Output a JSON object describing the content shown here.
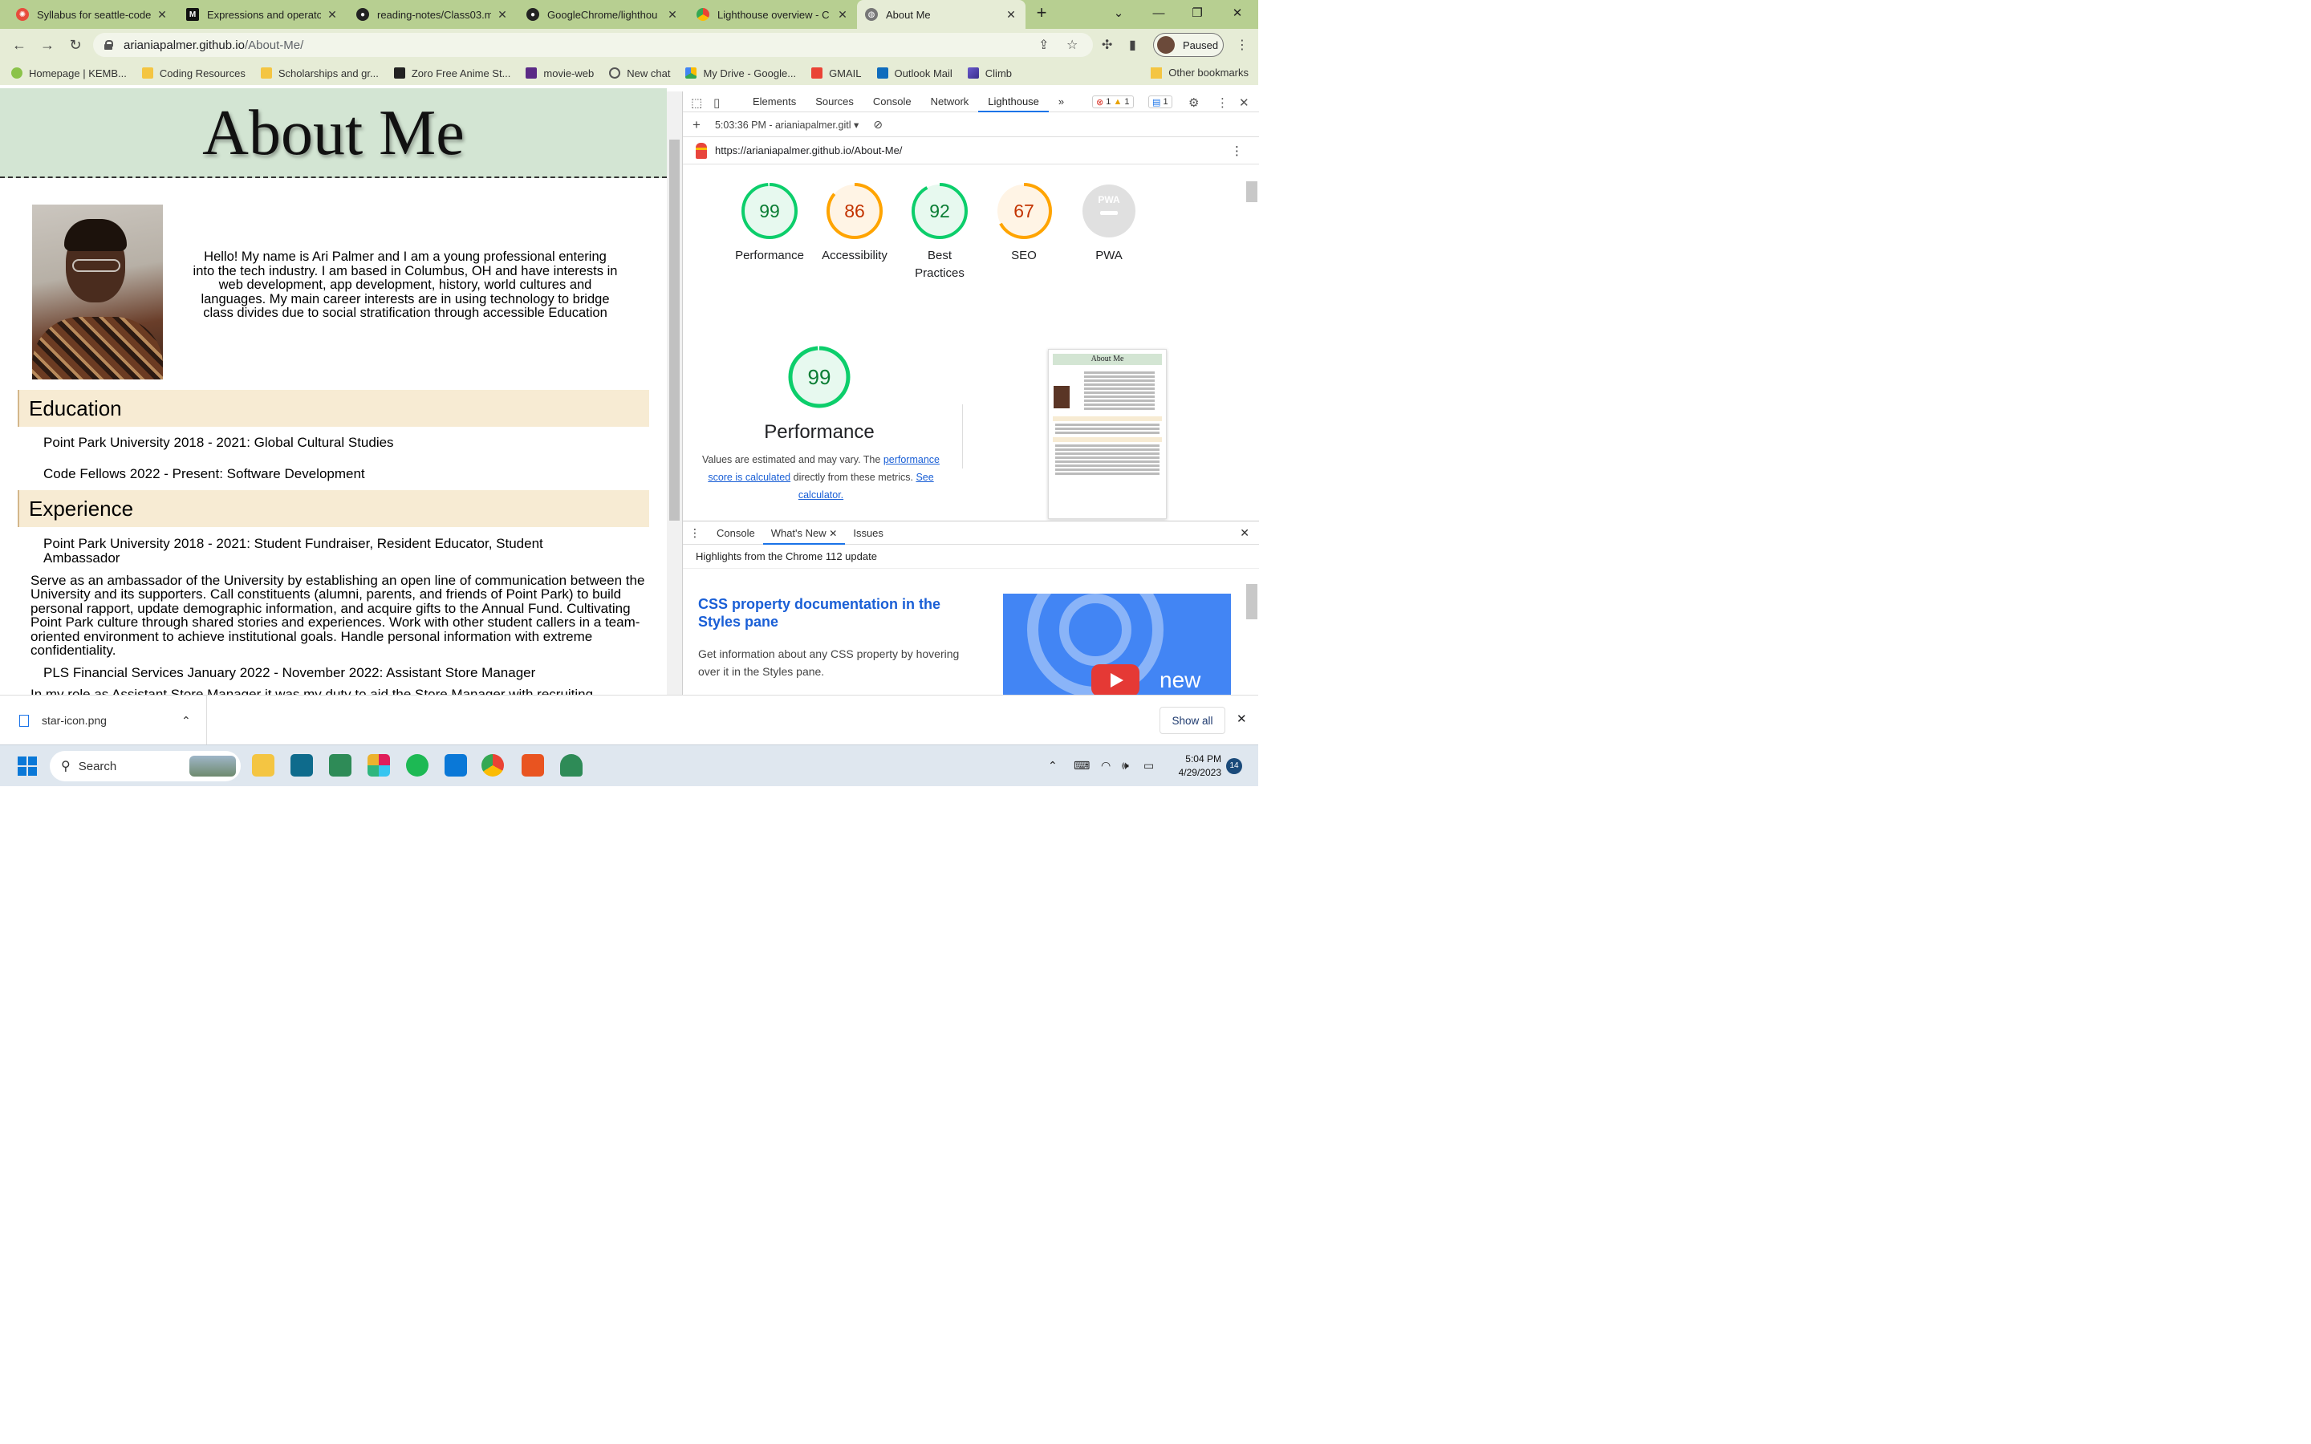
{
  "browser": {
    "tabs": [
      {
        "title": "Syllabus for seattle-code",
        "icon": "canvas-icon",
        "color": "#e74c3c"
      },
      {
        "title": "Expressions and operato",
        "icon": "mdn-icon",
        "color": "#111111"
      },
      {
        "title": "reading-notes/Class03.m",
        "icon": "github-icon",
        "color": "#222222"
      },
      {
        "title": "GoogleChrome/lighthou",
        "icon": "github-icon",
        "color": "#222222"
      },
      {
        "title": "Lighthouse overview - C",
        "icon": "chrome-icon",
        "color": "#4285f4"
      },
      {
        "title": "About Me",
        "icon": "globe-icon",
        "color": "#777777"
      }
    ],
    "new_tab": "+",
    "url_host": "ariania palmer.github.io",
    "url_display_host": "arianiapalmer.github.io",
    "url_path": "/About-Me/",
    "profile_label": "Paused",
    "bookmarks": [
      {
        "label": "Homepage | KEMB...",
        "icon": "leaf-icon"
      },
      {
        "label": "Coding Resources",
        "icon": "folder-icon"
      },
      {
        "label": "Scholarships and gr...",
        "icon": "folder-icon"
      },
      {
        "label": "Zoro Free Anime St...",
        "icon": "zoro-icon"
      },
      {
        "label": "movie-web",
        "icon": "movie-icon"
      },
      {
        "label": "New chat",
        "icon": "openai-icon"
      },
      {
        "label": "My Drive - Google...",
        "icon": "drive-icon"
      },
      {
        "label": "GMAIL",
        "icon": "gmail-icon"
      },
      {
        "label": "Outlook Mail",
        "icon": "outlook-icon"
      },
      {
        "label": "Climb",
        "icon": "climb-icon"
      }
    ],
    "other_bookmarks": "Other bookmarks"
  },
  "page": {
    "title": "About Me",
    "intro": "Hello! My name is Ari Palmer and I am a young professional entering into the tech industry. I am based in Columbus, OH and have interests in web development, app development, history, world cultures and languages. My main career interests are in using technology to bridge class divides due to social stratification through accessible Education",
    "education_heading": "Education",
    "education": [
      "Point Park University 2018 - 2021: Global Cultural Studies",
      "Code Fellows 2022 - Present: Software Development"
    ],
    "experience_heading": "Experience",
    "job1_title": "Point Park University 2018 - 2021: Student Fundraiser, Resident Educator, Student Ambassador",
    "job1_desc": "Serve as an ambassador of the University by establishing an open line of communication between the University and its supporters. Call constituents (alumni, parents, and friends of Point Park) to build personal rapport, update demographic information, and acquire gifts to the Annual Fund. Cultivating Point Park culture through shared stories and experiences. Work with other student callers in a team-oriented environment to achieve institutional goals. Handle personal information with extreme confidentiality.",
    "job2_title": "PLS Financial Services January 2022 - November 2022: Assistant Store Manager",
    "job2_desc": "In my role as Assistant Store Manager it was my duty to aid the Store Manager with recruiting"
  },
  "devtools": {
    "tabs": [
      "Elements",
      "Sources",
      "Console",
      "Network",
      "Lighthouse"
    ],
    "active_tab": "Lighthouse",
    "more": "»",
    "errors": "1",
    "warnings": "1",
    "messages": "1",
    "report_select": "5:03:36 PM - arianiapalmer.gitl",
    "report_url": "https://arianiapalmer.github.io/About-Me/",
    "scores": [
      {
        "label": "Performance",
        "value": 99,
        "color": "#0cce6b"
      },
      {
        "label": "Accessibility",
        "value": 86,
        "color": "#ffa400"
      },
      {
        "label": "Best Practices",
        "value": 92,
        "color": "#0cce6b"
      },
      {
        "label": "SEO",
        "value": 67,
        "color": "#ffa400"
      },
      {
        "label": "PWA",
        "value": null,
        "color": "#cccccc"
      }
    ],
    "pwa_badge": "PWA",
    "perf_score": "99",
    "perf_title": "Performance",
    "perf_note_1": "Values are estimated and may vary. The ",
    "perf_link_1": "performance score is calculated",
    "perf_note_2": " directly from these metrics. ",
    "perf_link_2": "See calculator.",
    "thumb_title": "About Me",
    "drawer_tabs": [
      "Console",
      "What's New",
      "Issues"
    ],
    "drawer_active": "What's New",
    "highlights": "Highlights from the Chrome 112 update",
    "whatsnew_title": "CSS property documentation in the Styles pane",
    "whatsnew_desc": "Get information about any CSS property by hovering over it in the Styles pane.",
    "video_badge": "new"
  },
  "downloads": {
    "file": "star-icon.png",
    "show_all": "Show all"
  },
  "taskbar": {
    "search_placeholder": "Search",
    "time": "5:04 PM",
    "date": "4/29/2023",
    "notifications": "14"
  }
}
